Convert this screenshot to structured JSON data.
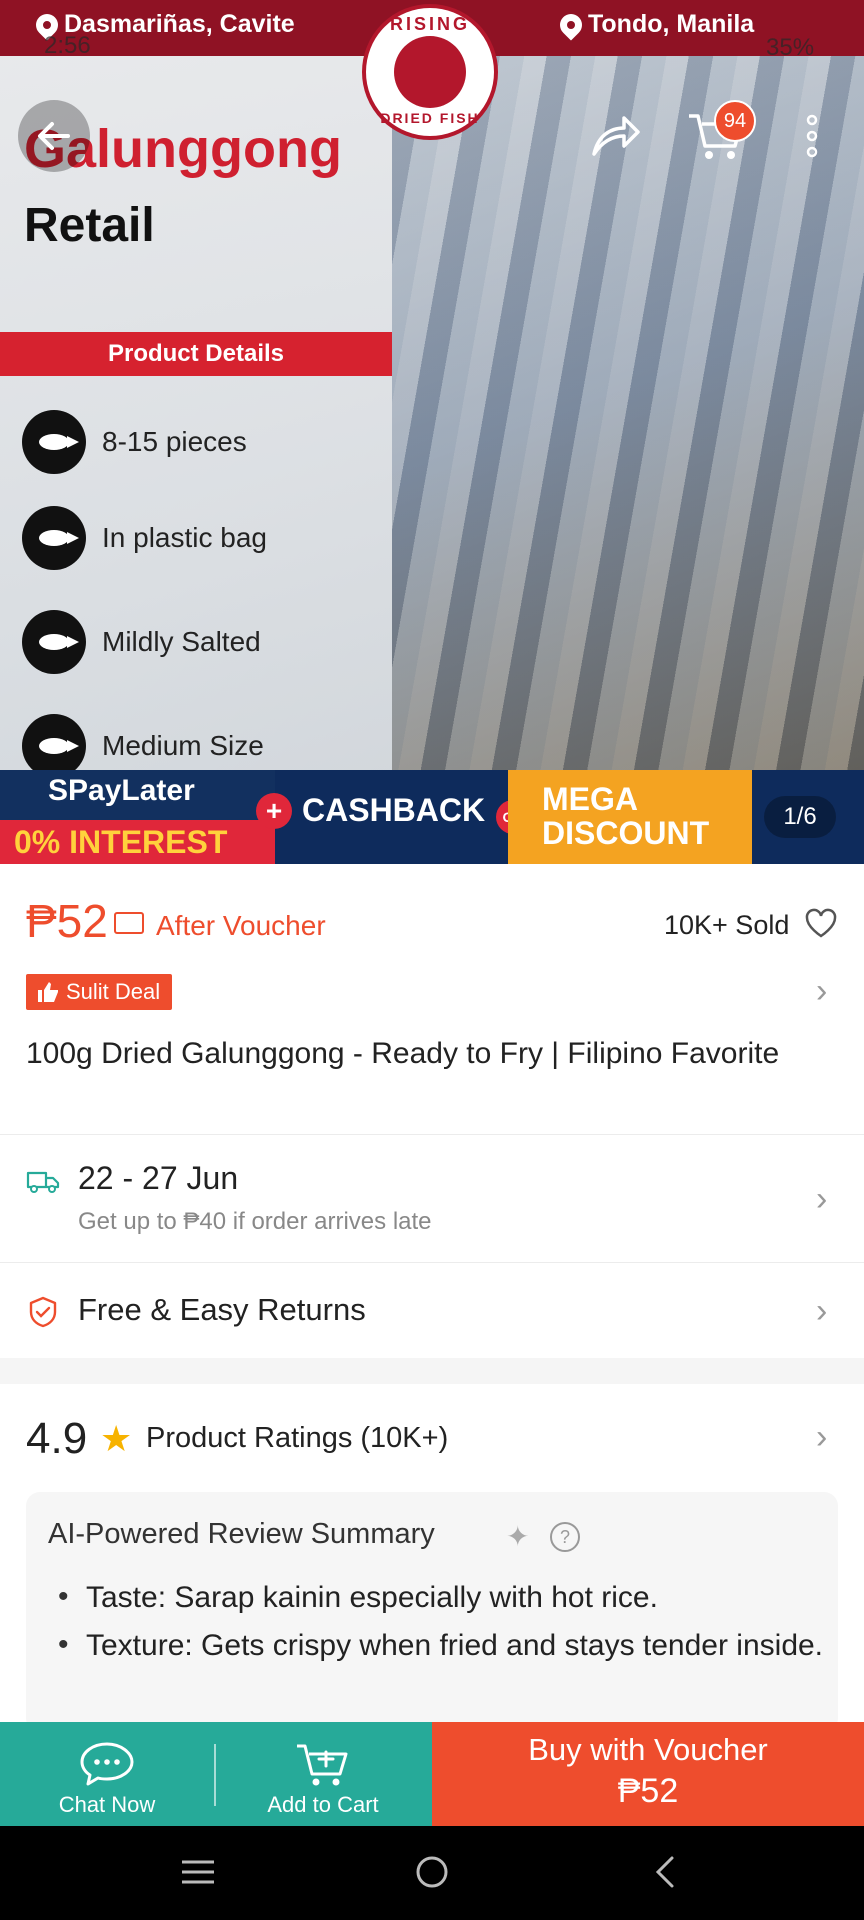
{
  "status_bar": {
    "time": "2:56",
    "battery": "35%"
  },
  "banner": {
    "location_left": "Dasmariñas, Cavite",
    "location_right": "Tondo, Manila",
    "logo_top": "RISING",
    "logo_bottom": "DRIED FISH",
    "title": "Galunggong",
    "subtitle": "Retail",
    "details_heading": "Product Details",
    "features": [
      "8-15 pieces",
      "In plastic bag",
      "Mildly Salted",
      "Medium Size"
    ],
    "promo_left_top": "SPayLater",
    "promo_left_bottom": "0% INTEREST",
    "promo_cashback": "CASHBACK",
    "promo_or": "OR",
    "promo_mega_1": "MEGA",
    "promo_mega_2": "DISCOUNT",
    "page_indicator": "1/6"
  },
  "top_actions": {
    "cart_count": "94"
  },
  "product": {
    "price": "₱52",
    "after_voucher": "After Voucher",
    "sold": "10K+ Sold",
    "deal_label": "Sulit Deal",
    "title": "100g Dried Galunggong - Ready to Fry | Filipino Favorite"
  },
  "shipping": {
    "dates": "22 - 27 Jun",
    "late_note": "Get up to ₱40 if order arrives late"
  },
  "returns": {
    "label": "Free & Easy Returns"
  },
  "ratings": {
    "score": "4.9",
    "label": "Product Ratings (10K+)"
  },
  "ai_summary": {
    "title": "AI-Powered Review Summary",
    "help": "?",
    "points": [
      "Taste: Sarap kainin especially with hot rice.",
      "Texture: Gets crispy when fried and stays tender inside."
    ]
  },
  "bottom_bar": {
    "chat_label": "Chat Now",
    "cart_label": "Add to Cart",
    "buy_label": "Buy with Voucher",
    "buy_price": "₱52"
  },
  "colors": {
    "accent": "#ee4d2d",
    "teal": "#26aa99",
    "brand_red": "#8f1224"
  }
}
